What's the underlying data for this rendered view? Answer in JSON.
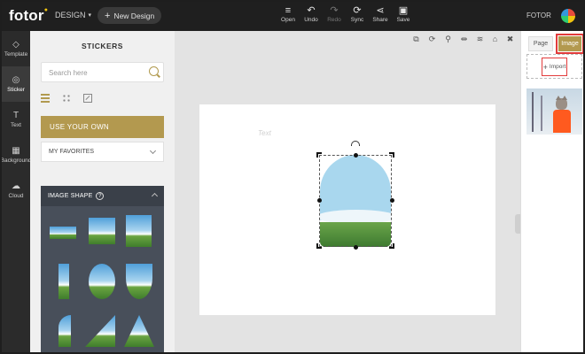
{
  "app": {
    "logo": "fotor",
    "design_menu": "DESIGN",
    "new_design": "New Design",
    "user": "FOTOR"
  },
  "toolbar": [
    {
      "label": "Open",
      "icon": "menu-icon",
      "glyph": "≡",
      "enabled": true
    },
    {
      "label": "Undo",
      "icon": "undo-icon",
      "glyph": "↶",
      "enabled": true
    },
    {
      "label": "Redo",
      "icon": "redo-icon",
      "glyph": "↷",
      "enabled": false
    },
    {
      "label": "Sync",
      "icon": "sync-icon",
      "glyph": "⟳",
      "enabled": true
    },
    {
      "label": "Share",
      "icon": "share-icon",
      "glyph": "⋖",
      "enabled": true
    },
    {
      "label": "Save",
      "icon": "save-icon",
      "glyph": "▣",
      "enabled": true
    }
  ],
  "leftnav": [
    {
      "label": "Template",
      "icon": "template-icon",
      "glyph": "◇",
      "active": false
    },
    {
      "label": "Sticker",
      "icon": "sticker-icon",
      "glyph": "◎",
      "active": true
    },
    {
      "label": "Text",
      "icon": "text-icon",
      "glyph": "T",
      "active": false
    },
    {
      "label": "Background",
      "icon": "background-icon",
      "glyph": "▦",
      "active": false
    },
    {
      "label": "Cloud",
      "icon": "cloud-icon",
      "glyph": "☁",
      "active": false
    }
  ],
  "stickers": {
    "title": "STICKERS",
    "search_placeholder": "Search here",
    "use_your_own": "USE YOUR OWN",
    "my_favorites": "MY FAVORITES",
    "image_shape": "IMAGE SHAPE",
    "help": "?"
  },
  "canvas": {
    "ghost_text": "Text"
  },
  "right_panel": {
    "tab_page": "Page",
    "tab_image": "Image",
    "import": "Import"
  },
  "colors": {
    "accent": "#b3994f",
    "topbar": "#1f1f1f",
    "highlight": "#e23b3b"
  }
}
